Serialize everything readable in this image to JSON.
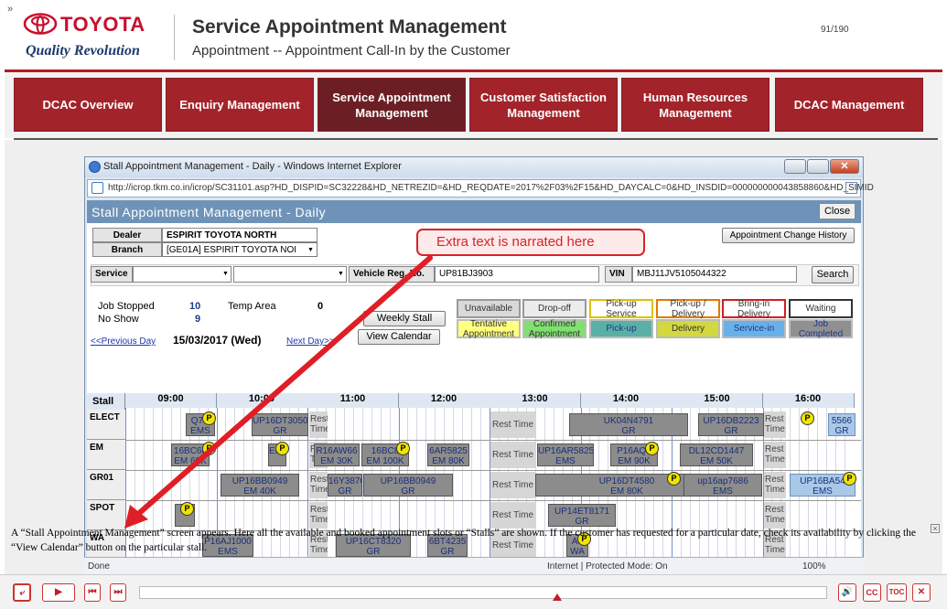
{
  "header": {
    "logo_text": "TOYOTA",
    "logo_tagline": "Quality Revolution",
    "title": "Service Appointment Management",
    "subtitle": "Appointment --  Appointment Call-In by the Customer",
    "page_counter": "91/190",
    "chevron": "»"
  },
  "nav": {
    "items": [
      {
        "label": "DCAC Overview"
      },
      {
        "label": "Enquiry Management"
      },
      {
        "label": "Service Appointment Management"
      },
      {
        "label": "Customer Satisfaction Management"
      },
      {
        "label": "Human Resources Management"
      },
      {
        "label": "DCAC Management"
      }
    ]
  },
  "browser": {
    "window_title": "Stall Appointment Management - Daily - Windows Internet Explorer",
    "url": "http://icrop.tkm.co.in/icrop/SC31101.asp?HD_DISPID=SC32228&HD_NETREZID=&HD_REQDATE=2017%2F03%2F15&HD_DAYCALC=0&HD_INSDID=000000000043858860&HD_SIMID",
    "status_done": "Done",
    "status_zone": "Internet | Protected Mode: On",
    "zoom": "100%"
  },
  "app": {
    "title": "Stall Appointment Management - Daily",
    "close": "Close",
    "dealer_label": "Dealer",
    "dealer_value": "ESPIRIT TOYOTA NORTH",
    "branch_label": "Branch",
    "branch_value": "[GE01A] ESPIRIT TOYOTA NOI",
    "history_btn": "Appointment Change History",
    "service_label": "Service",
    "vehicle_label": "Vehicle Reg. No.",
    "vehicle_value": "UP81BJ3903",
    "vin_label": "VIN",
    "vin_value": "MBJ11JV5105044322",
    "search_btn": "Search",
    "job_stopped_label": "Job Stopped",
    "job_stopped_value": "10",
    "temp_area_label": "Temp Area",
    "temp_area_value": "0",
    "no_show_label": "No Show",
    "no_show_value": "9",
    "weekly_btn": "Weekly Stall",
    "calendar_btn": "View Calendar",
    "prev_day": "<<Previous Day",
    "date": "15/03/2017 (Wed)",
    "next_day": "Next Day>>",
    "legend": [
      {
        "label": "Unavailable",
        "bg": "#d9d9d9",
        "border": "#999"
      },
      {
        "label": "Drop-off",
        "bg": "#ececec",
        "border": "#999"
      },
      {
        "label": "Pick-up Service",
        "bg": "#fff",
        "border": "#e0c000"
      },
      {
        "label": "Pick-up / Delivery",
        "bg": "#fff",
        "border": "#e07a00"
      },
      {
        "label": "Bring-in Delivery",
        "bg": "#fff",
        "border": "#d02020"
      },
      {
        "label": "Waiting",
        "bg": "#fff",
        "border": "#333"
      },
      {
        "label": "Tentative Appointment",
        "bg": "#ffff80",
        "border": "#bbb"
      },
      {
        "label": "Confirmed Appointment",
        "bg": "#80e070",
        "border": "#bbb"
      },
      {
        "label": "Pick-up",
        "bg": "#5ab0a6",
        "border": "#bbb"
      },
      {
        "label": "Delivery",
        "bg": "#d4d840",
        "border": "#bbb"
      },
      {
        "label": "Service-in",
        "bg": "#6ab0e8",
        "border": "#bbb"
      },
      {
        "label": "Job Completed",
        "bg": "#909090",
        "border": "#bbb"
      }
    ],
    "stall_label": "Stall",
    "hours": [
      "09:00",
      "10:00",
      "11:00",
      "12:00",
      "13:00",
      "14:00",
      "15:00",
      "16:00"
    ],
    "rows": [
      "ELECT",
      "EM",
      "GR01",
      "SPOT",
      "WA"
    ],
    "rest_label": "Rest Time",
    "rest_short": "Rest",
    "rest_time_word": "Time"
  },
  "blocks": [
    {
      "t": "Q7C",
      "s": "EMS"
    },
    {
      "t": "UP16DT3050",
      "s": "GR"
    },
    {
      "t": "UK04N4791",
      "s": "GR"
    },
    {
      "t": "UP16DB2223",
      "s": "GR"
    },
    {
      "t": "5566",
      "s": "GR"
    },
    {
      "t": "16BC68",
      "s": "EM 60K"
    },
    {
      "t": "",
      "s": "EM 5"
    },
    {
      "t": "R16AW66",
      "s": "EM 30K"
    },
    {
      "t": "16BC8",
      "s": "EM 100K"
    },
    {
      "t": "6AR5825",
      "s": "EM 80K"
    },
    {
      "t": "UP16AR5825",
      "s": "EMS"
    },
    {
      "t": "P16AQ4",
      "s": "EM 90K"
    },
    {
      "t": "DL12CD1447",
      "s": "EM 50K"
    },
    {
      "t": "UP16BB0949",
      "s": "EM 40K"
    },
    {
      "t": "16Y3870",
      "s": "GR"
    },
    {
      "t": "UP16BB0949",
      "s": "GR"
    },
    {
      "t": "UP16DT4580",
      "s": "EM 80K"
    },
    {
      "t": "up16ap7686",
      "s": "EMS"
    },
    {
      "t": "UP16BA54",
      "s": "EMS"
    },
    {
      "t": "UP14ET8171",
      "s": "GR"
    },
    {
      "t": "P16AJ1000",
      "s": "EMS"
    },
    {
      "t": "UP16CT8320",
      "s": "GR"
    },
    {
      "t": "6BT4235",
      "s": "GR"
    },
    {
      "t": "A5",
      "s": "WA"
    }
  ],
  "callout": "Extra text is narrated here",
  "caption": "A “Stall Appointment Management” screen appears. Here all the available and booked appointment slots or “Stalls” are shown. If the customer has requested for a particular date, check its availability by clicking the “View Calendar” button on the particular stall.",
  "player": {
    "exit": "⤶",
    "cc": "CC",
    "toc": "TOC",
    "close": "✕"
  }
}
